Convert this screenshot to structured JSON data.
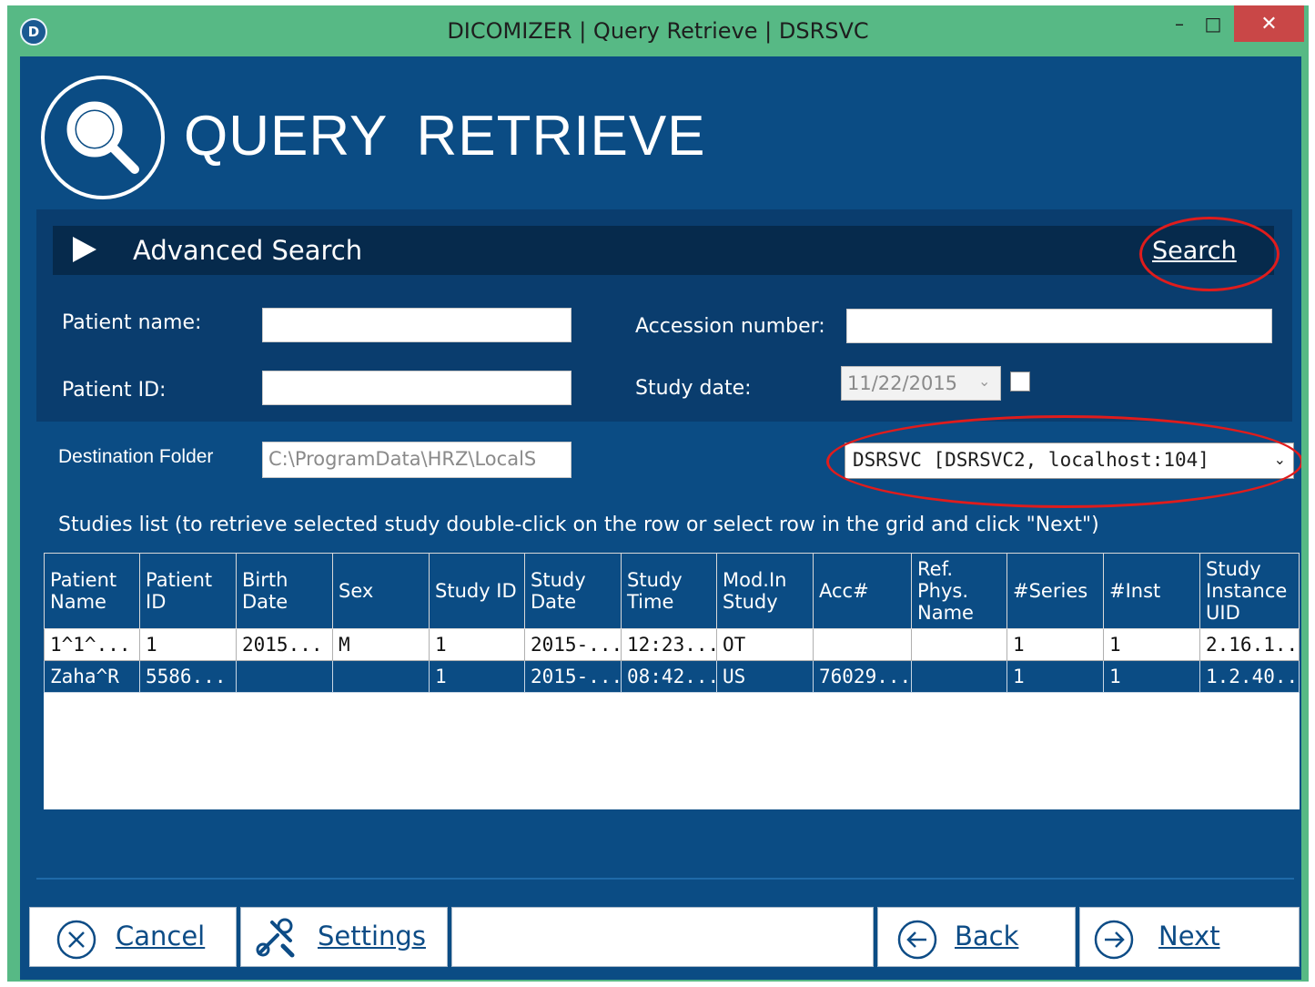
{
  "window": {
    "title": "DICOMIZER | Query Retrieve | DSRSVC",
    "logo": "D",
    "controls": {
      "minimize": "–",
      "maximize": "□",
      "close": "✕"
    }
  },
  "header": {
    "title": "QUERY  RETRIEVE",
    "icon": "magnifier-icon"
  },
  "advanced": {
    "label": "Advanced Search",
    "search_link": "Search",
    "patient_name_label": "Patient name:",
    "patient_name_value": "",
    "patient_id_label": "Patient ID:",
    "patient_id_value": "",
    "accession_label": "Accession number:",
    "accession_value": "",
    "study_date_label": "Study date:",
    "study_date_value": "11/22/2015",
    "study_date_checked": false
  },
  "destination": {
    "label": "Destination Folder",
    "value": "C:\\ProgramData\\HRZ\\LocalS",
    "server_selected": "DSRSVC [DSRSVC2, localhost:104]"
  },
  "studies": {
    "caption": "Studies list (to retrieve selected study double-click on the row or select row in the grid and click \"Next\")",
    "columns": [
      "Patient Name",
      "Patient ID",
      "Birth Date",
      "Sex",
      "Study ID",
      "Study Date",
      "Study Time",
      "Mod.In Study",
      "Acc#",
      "Ref. Phys. Name",
      "#Series",
      "#Inst",
      "Study Instance UID"
    ],
    "rows": [
      [
        "1^1^...",
        "1",
        "2015...",
        "M",
        "1",
        "2015-...",
        "12:23...",
        "OT",
        "",
        "",
        "1",
        "1",
        "2.16.1..."
      ],
      [
        "Zaha^R",
        "5586...",
        "",
        "",
        "1",
        "2015-...",
        "08:42...",
        "US",
        "76029...",
        "",
        "1",
        "1",
        "1.2.40..."
      ]
    ],
    "selected_row": 1
  },
  "footer": {
    "cancel": "Cancel",
    "settings": "Settings",
    "back": "Back",
    "next": "Next"
  },
  "colors": {
    "frame": "#57b985",
    "panel": "#0b4c84",
    "panel_dark": "#0a3d6e",
    "bar": "#062a4c",
    "highlight_ring": "#e01c1c"
  }
}
